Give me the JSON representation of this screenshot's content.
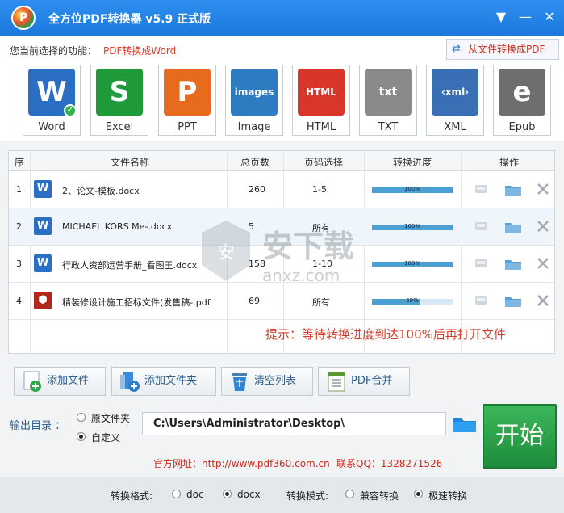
{
  "window": {
    "title": "全方位PDF转换器 v5.9 正式版",
    "logo_letter": "P",
    "menu_glyph": "▼",
    "minimize_glyph": "—",
    "close_glyph": "✕"
  },
  "function": {
    "label": "您当前选择的功能：",
    "value": "PDF转换成Word",
    "switch_label": "从文件转换成PDF",
    "switch_glyph": "⇄"
  },
  "formats": [
    {
      "label": "Word",
      "color": "#2b6fc4",
      "glyph": "W",
      "checked": true
    },
    {
      "label": "Excel",
      "color": "#1f9a3a",
      "glyph": "S"
    },
    {
      "label": "PPT",
      "color": "#e86a1c",
      "glyph": "P"
    },
    {
      "label": "Image",
      "color": "#2d7bc0",
      "glyph": "images"
    },
    {
      "label": "HTML",
      "color": "#d9362a",
      "glyph": "HTML"
    },
    {
      "label": "TXT",
      "color": "#8a8a8a",
      "glyph": "txt"
    },
    {
      "label": "XML",
      "color": "#3a6fb5",
      "glyph": "‹xml›"
    },
    {
      "label": "Epub",
      "color": "#6e6e6e",
      "glyph": "e"
    }
  ],
  "table": {
    "headers": [
      "序",
      "文件名称",
      "总页数",
      "页码选择",
      "转换进度",
      "操作"
    ],
    "rows": [
      {
        "index": "1",
        "name": "2、论文-模板.docx",
        "pages": "260",
        "range": "1-5",
        "progress": 1.0,
        "progress_text": "100%",
        "type": "word"
      },
      {
        "index": "2",
        "name": "MICHAEL KORS Me-.docx",
        "pages": "5",
        "range": "所有",
        "progress": 1.0,
        "progress_text": "100%",
        "type": "word"
      },
      {
        "index": "3",
        "name": "行政人资部运营手册_看图王.docx",
        "pages": "158",
        "range": "1-10",
        "progress": 1.0,
        "progress_text": "100%",
        "type": "word"
      },
      {
        "index": "4",
        "name": "精装修设计施工招标文件(发售稿-.pdf",
        "pages": "69",
        "range": "所有",
        "progress": 0.59,
        "progress_text": "59%",
        "type": "pdf"
      }
    ],
    "hint": "提示：等待转换进度到达100%后再打开文件"
  },
  "watermark": {
    "text": "安下载",
    "sub": "anxz.com",
    "badge": "安"
  },
  "toolbar": {
    "add_file": "添加文件",
    "add_folder": "添加文件夹",
    "clear_list": "清空列表",
    "pdf_merge": "PDF合并"
  },
  "output": {
    "label": "输出目录 ：",
    "option_original": "原文件夹",
    "option_custom": "自定义",
    "selected": "custom",
    "path": "C:\\Users\\Administrator\\Desktop\\",
    "start_label": "开始"
  },
  "footer": {
    "website": "官方网址：http://www.pdf360.com.cn",
    "qq": "联系QQ：1328271526"
  },
  "options": {
    "format_label": "转换格式:",
    "format_doc": "doc",
    "format_docx": "docx",
    "format_selected": "docx",
    "mode_label": "转换模式:",
    "mode_compat": "兼容转换",
    "mode_fast": "极速转换",
    "mode_selected": "fast"
  }
}
